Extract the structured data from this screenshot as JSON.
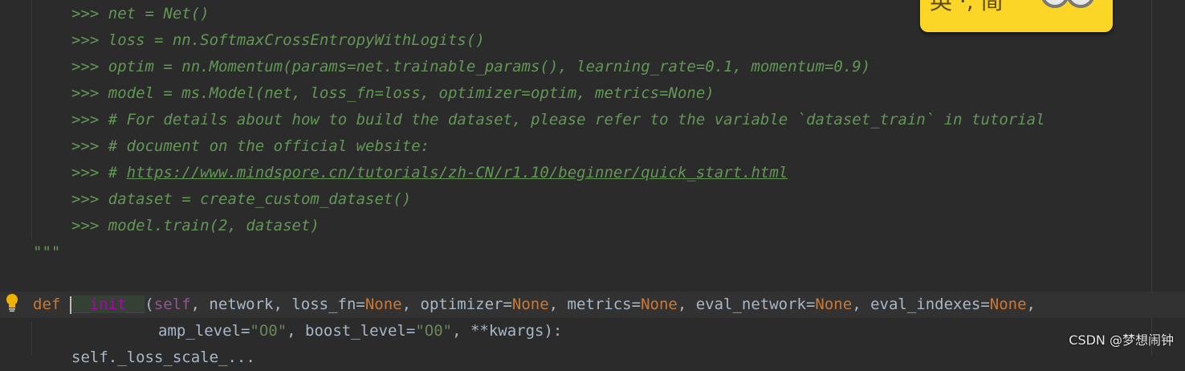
{
  "code_lines": {
    "l1": ">>> net = Net()",
    "l2": ">>> loss = nn.SoftmaxCrossEntropyWithLogits()",
    "l3": ">>> optim = nn.Momentum(params=net.trainable_params(), learning_rate=0.1, momentum=0.9)",
    "l4": ">>> model = ms.Model(net, loss_fn=loss, optimizer=optim, metrics=None)",
    "l5": ">>> # For details about how to build the dataset, please refer to the variable `dataset_train` in tutorial",
    "l6": ">>> # document on the official website:",
    "l7_prefix": ">>> # ",
    "l7_link": "https://www.mindspore.cn/tutorials/zh-CN/r1.10/beginner/quick_start.html",
    "l8": ">>> dataset = create_custom_dataset()",
    "l9": ">>> model.train(2, dataset)",
    "l10": "\"\"\""
  },
  "def_line": {
    "keyword": "def",
    "name": "__init__",
    "open": "(",
    "self": "self",
    "rest_1": ", network, loss_fn=",
    "none_1": "None",
    "rest_2": ", optimizer=",
    "none_2": "None",
    "rest_3": ", metrics=",
    "none_3": "None",
    "rest_4": ", eval_network=",
    "none_4": "None",
    "rest_5": ", eval_indexes=",
    "none_5": "None",
    "rest_6": ","
  },
  "cont_line": {
    "a": "amp_level=",
    "s1": "\"O0\"",
    "b": ", boost_level=",
    "s2": "\"O0\"",
    "c": ", **kwargs):"
  },
  "partial_line": "self._loss_scale_...",
  "ime_widget": {
    "text": "英 ·, 简"
  },
  "watermark": "CSDN @梦想闹钟",
  "colors": {
    "background": "#2b2b2b",
    "docstring": "#629755",
    "keyword": "#cc7832",
    "function": "#b200b2",
    "self": "#94558d",
    "string": "#6a8759",
    "text": "#a9b7c6"
  }
}
